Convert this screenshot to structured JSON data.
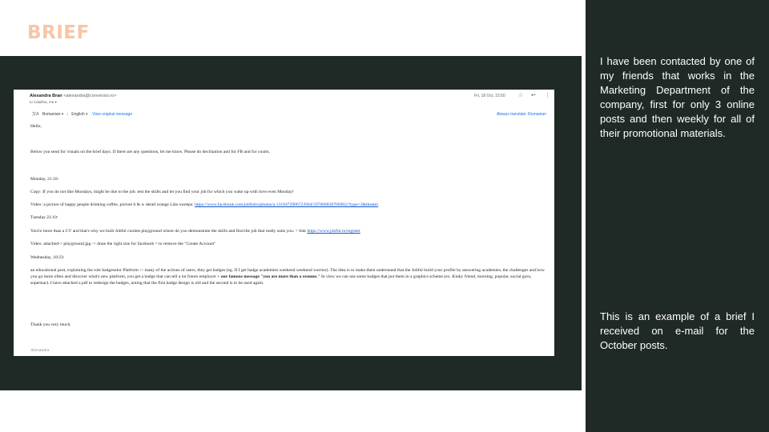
{
  "slide": {
    "title": "BRIEF",
    "right_top": "I have been contacted by one of my friends that works in the Marketing Department of the company, first for only 3 online posts and then weekly for all of their promotional materials.",
    "right_bottom": "This is an example of a brief I received on e-mail for the October posts."
  },
  "email": {
    "sender_name": "Alexandra Bran",
    "sender_addr": "<alexandra@conversio.ro>",
    "to": "to Catalina, me",
    "date": "Fri, 18 Oct, 15:50",
    "icons": {
      "star": "star-icon",
      "reply": "reply-icon",
      "more": "more-vert-icon"
    },
    "translate": {
      "from": "Romanian",
      "to": "English",
      "view_original": "View original message",
      "always": "Always translate: Romanian"
    },
    "body": {
      "greeting": "Hello,",
      "intro": "Below you send for visuals on the brief days. If there are any questions, let me know. Please do declination and for FB and for courts.",
      "monday_head": "Monday, 21.10:",
      "monday_copy": "Copy: If you do not like Mondays, might be due to the job. test the skills and let you find your job for which you wake up with love even Monday!",
      "monday_video_text": "Video: a picture of happy people drinking coffee, picture b & w detail orange Like sweeps: ",
      "monday_video_link": "https://www.facebook.com/jobfulro/photos/a.1319472906723944/597668830766902/?type=3&theater",
      "tuesday_head": "Tuesday 22.10:",
      "tuesday_copy_text": "You're more than a CV and that's why we built Jobful coolest playground where do you demonstrate the skills and find the job that really suits you. = link ",
      "tuesday_copy_link": "https://www.jobful.ro/register",
      "tuesday_video": "Video: attached-> playground.jpg -> done the right size for facebook = to remove the \"Create Account\"",
      "wednesday_head": "Wednesday, 10/23:",
      "wednesday_a": "an educational post, explaining the role badgesnlor Platform -> many of the actions of users, they get badges (eg. If I get badge academies weekend weekend warrior). The idea is to make them understand that the Jobful build your profile by answering academies, the challenges and how you go more often and discover what's new platform, you get a badge that can tell a lot future employer ",
      "wednesday_bold": "+ our famous message \"you are more than a resume.\"",
      "wednesday_b": " In view we can use some badges that put them in a graphics scheme (ex. Kinky friend, morning, popular, social guru, superstar). I have attached a pdf to redesign the badges, noting that the first badge design is old and the second is to be used again.",
      "thanks": "Thank you very much.",
      "signature": "Alexandra"
    }
  }
}
